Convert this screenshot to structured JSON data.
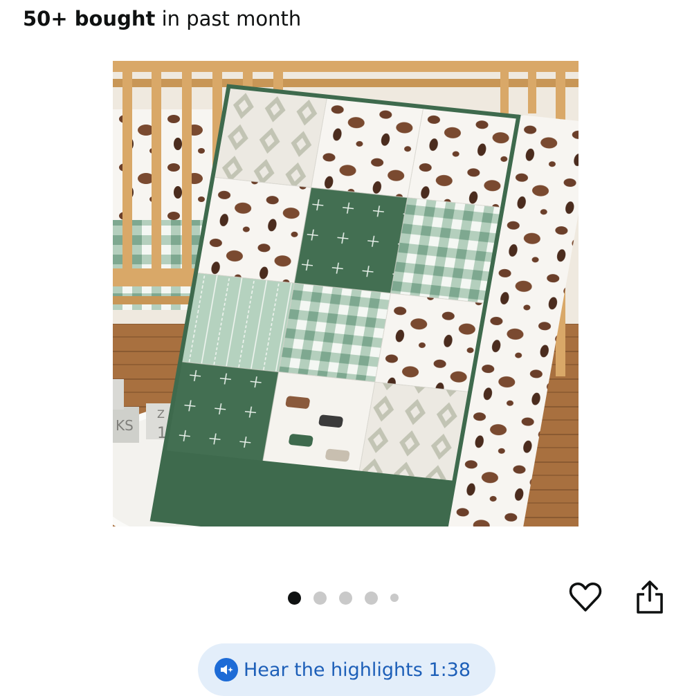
{
  "purchase_info": {
    "count": "50+ bought",
    "suffix": "in past month"
  },
  "product_image": {
    "alt": "Patchwork baby quilt with cow print, green gingham and farm animal squares leaning against a wooden crib",
    "block_text": "KS",
    "block_number": "1",
    "block_digit_top": "Z"
  },
  "carousel": {
    "total_dots": 5,
    "active_index": 0
  },
  "actions": {
    "wishlist_icon": "heart-icon",
    "share_icon": "share-icon"
  },
  "audio_highlights": {
    "label": "Hear the highlights 1:38",
    "icon": "audio-sparkle-icon"
  },
  "colors": {
    "accent_blue": "#1d6bd6",
    "pill_bg": "#e3eefa",
    "quilt_green": "#3f6b4e",
    "crib_wood": "#d9a868"
  }
}
